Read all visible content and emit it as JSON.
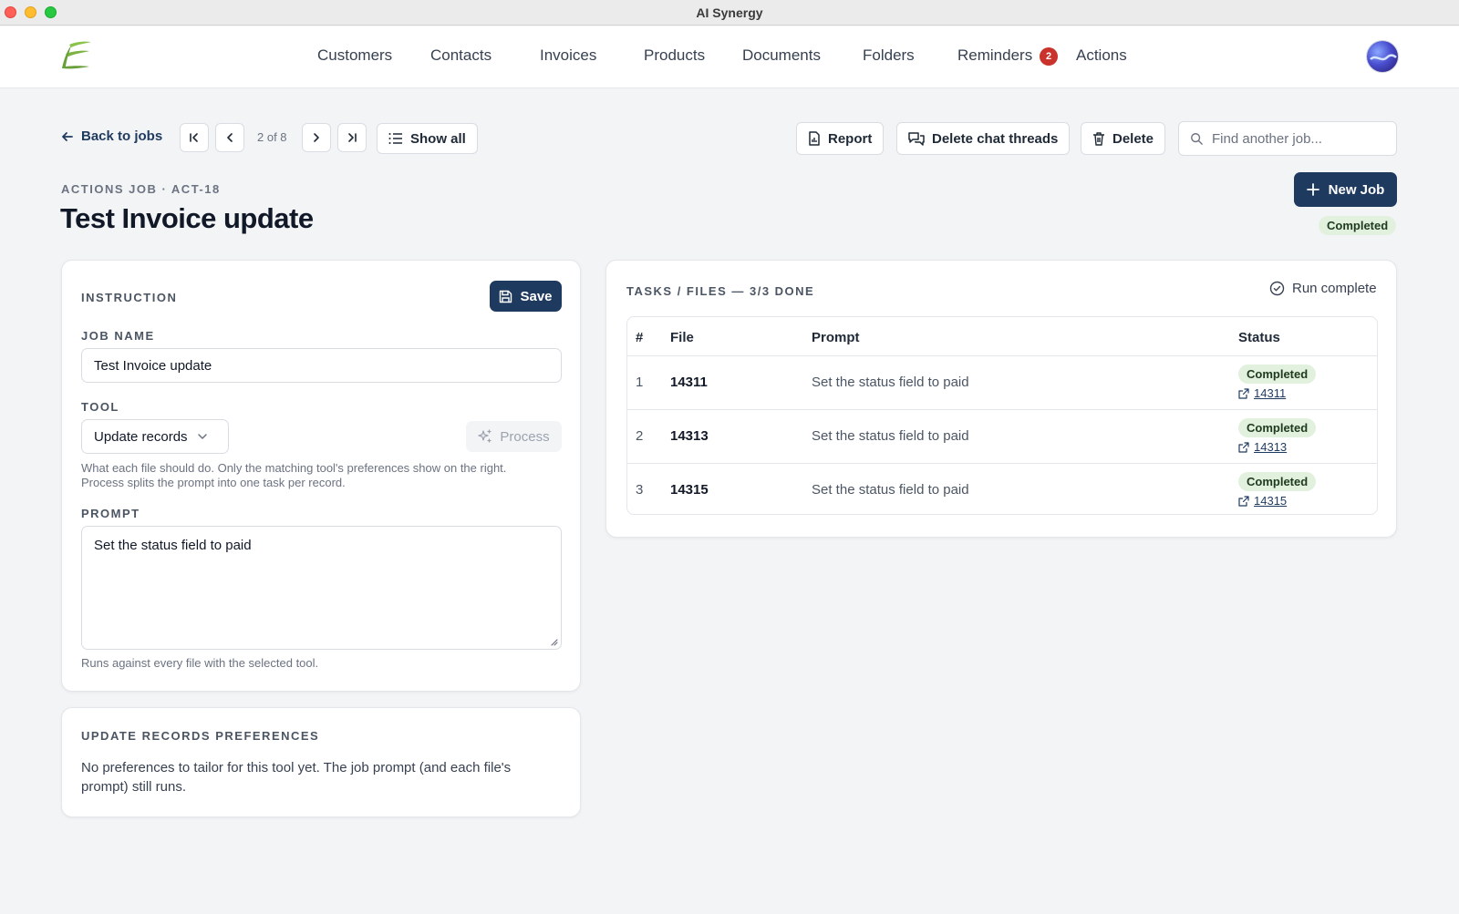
{
  "window": {
    "title": "AI Synergy"
  },
  "nav": {
    "items": [
      "Customers",
      "Contacts",
      "Invoices",
      "Products",
      "Documents",
      "Folders",
      "Reminders",
      "Actions"
    ],
    "reminders_badge": "2"
  },
  "toolbar": {
    "back_label": "Back to jobs",
    "pager": "2 of 8",
    "show_all": "Show all",
    "report": "Report",
    "delete_threads": "Delete chat threads",
    "delete": "Delete",
    "search_placeholder": "Find another job..."
  },
  "job": {
    "kicker": "ACTIONS JOB · ACT-18",
    "title": "Test Invoice update",
    "new_job": "New Job",
    "status": "Completed"
  },
  "instruction": {
    "section": "INSTRUCTION",
    "save": "Save",
    "job_name_label": "JOB NAME",
    "job_name_value": "Test Invoice update",
    "tool_label": "TOOL",
    "tool_value": "Update records",
    "process": "Process",
    "tool_help_1": "What each file should do. Only the matching tool's preferences show on the right.",
    "tool_help_2": "Process splits the prompt into one task per record.",
    "prompt_label": "PROMPT",
    "prompt_value": "Set the status field to paid",
    "prompt_help": "Runs against every file with the selected tool."
  },
  "prefs": {
    "section": "UPDATE RECORDS PREFERENCES",
    "text": "No preferences to tailor for this tool yet. The job prompt (and each file's prompt) still runs."
  },
  "tasks": {
    "section": "TASKS / FILES — 3/3 DONE",
    "run_status": "Run complete",
    "columns": [
      "#",
      "File",
      "Prompt",
      "Status"
    ],
    "rows": [
      {
        "num": "1",
        "file": "14311",
        "prompt": "Set the status field to paid",
        "status": "Completed",
        "link": "14311"
      },
      {
        "num": "2",
        "file": "14313",
        "prompt": "Set the status field to paid",
        "status": "Completed",
        "link": "14313"
      },
      {
        "num": "3",
        "file": "14315",
        "prompt": "Set the status field to paid",
        "status": "Completed",
        "link": "14315"
      }
    ]
  },
  "colors": {
    "primary": "#1f3a5f",
    "success_bg": "#e2f1dd",
    "badge_red": "#c9332b",
    "logo_green": "#7cb342"
  }
}
